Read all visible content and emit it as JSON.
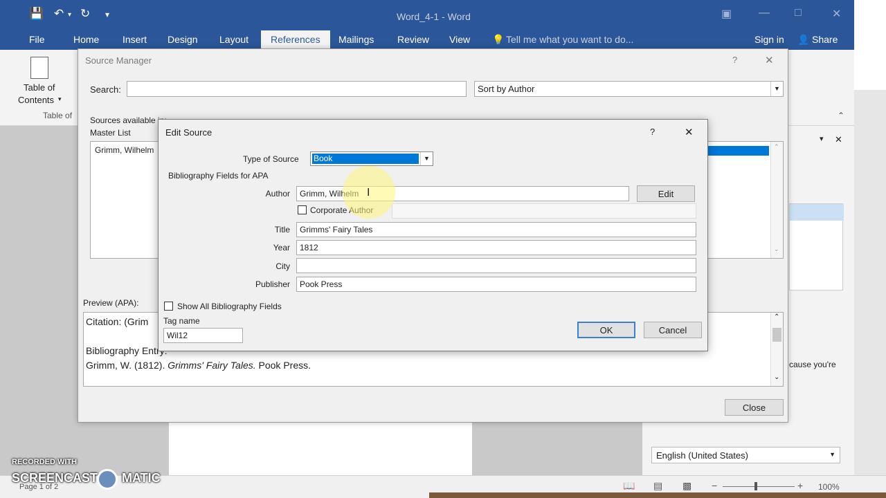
{
  "app": {
    "window_title": "Word_4-1 - Word",
    "tabs": [
      "File",
      "Home",
      "Insert",
      "Design",
      "Layout",
      "References",
      "Mailings",
      "Review",
      "View"
    ],
    "active_tab": "References",
    "tell_me": "Tell me what you want to do...",
    "sign_in": "Sign in",
    "share": "Share"
  },
  "ribbon": {
    "toc_label_1": "Table of",
    "toc_label_2": "Contents",
    "group_label": "Table of"
  },
  "source_manager": {
    "title": "Source Manager",
    "help": "?",
    "close_x": "✕",
    "search_label": "Search:",
    "search_value": "",
    "sort_value": "Sort by Author",
    "sources_label_1": "Sources available in:",
    "sources_label_2": "Master List",
    "master_item": "Grimm, Wilhelm",
    "preview_label": "Preview (APA):",
    "citation": "Citation:  (Grim",
    "bib_label": "Bibliography Entry:",
    "bib_author_year": "Grimm, W. (1812). ",
    "bib_title": "Grimms' Fairy Tales.",
    "bib_publisher": " Pook Press.",
    "close_button": "Close"
  },
  "edit_source": {
    "title": "Edit Source",
    "help": "?",
    "close_x": "✕",
    "type_label": "Type of Source",
    "type_value": "Book",
    "fields_heading": "Bibliography Fields for APA",
    "author_label": "Author",
    "author_value": "Grimm, Wilhelm",
    "edit_button": "Edit",
    "corporate_label": "Corporate Author",
    "title_label": "Title",
    "title_value": "Grimms' Fairy Tales",
    "year_label": "Year",
    "year_value": "1812",
    "city_label": "City",
    "city_value": "",
    "publisher_label": "Publisher",
    "publisher_value": "Pook Press",
    "show_all_label": "Show All Bibliography Fields",
    "tag_label": "Tag name",
    "tag_value": "Wil12",
    "ok_button": "OK",
    "cancel_button": "Cancel"
  },
  "side_pane": {
    "because_text": "cause you're",
    "language": "English (United States)"
  },
  "status": {
    "page": "Page 1 of 2",
    "zoom": "100%"
  },
  "watermark": {
    "line1": "RECORDED WITH",
    "line2": "SCREENCAST",
    "line3": "MATIC"
  },
  "colors": {
    "brand_blue": "#2b579a",
    "selection": "#0078d7",
    "highlight": "#fff578"
  }
}
